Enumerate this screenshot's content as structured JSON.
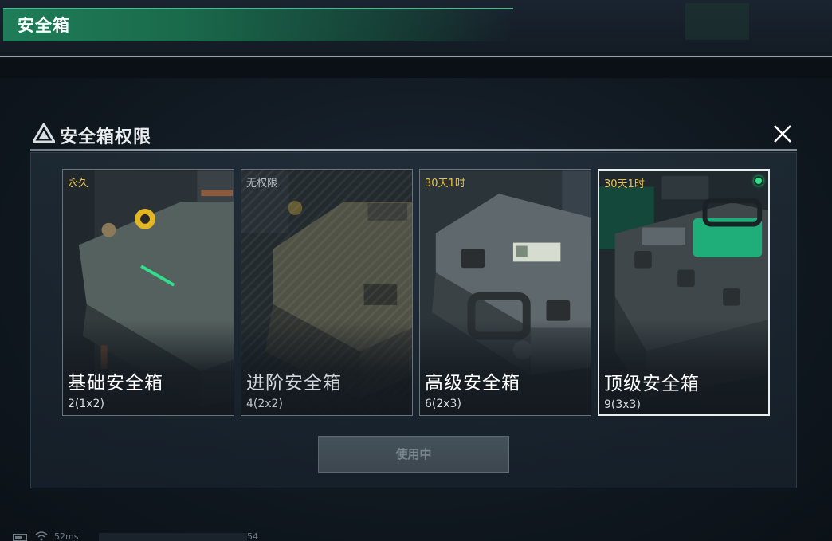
{
  "header": {
    "title": "安全箱"
  },
  "dialog": {
    "title": "安全箱权限",
    "close_icon": "close-icon",
    "warning_icon": "warning-triangle-icon"
  },
  "cards": [
    {
      "tag": "永久",
      "name": "基础安全箱",
      "size": "2(1x2)",
      "selected": false,
      "locked": false
    },
    {
      "tag": "无权限",
      "name": "进阶安全箱",
      "size": "4(2x2)",
      "selected": false,
      "locked": true
    },
    {
      "tag": "30天1时",
      "name": "高级安全箱",
      "size": "6(2x3)",
      "selected": false,
      "locked": false
    },
    {
      "tag": "30天1时",
      "name": "顶级安全箱",
      "size": "9(3x3)",
      "selected": true,
      "locked": false
    }
  ],
  "action_button": {
    "label": "使用中",
    "enabled": false
  },
  "status_bar": {
    "ping": "52ms",
    "number": "54"
  },
  "colors": {
    "accent_green": "#2fe08d",
    "tag_gold": "#e7c34b",
    "banner_green": "#1f7d58"
  }
}
